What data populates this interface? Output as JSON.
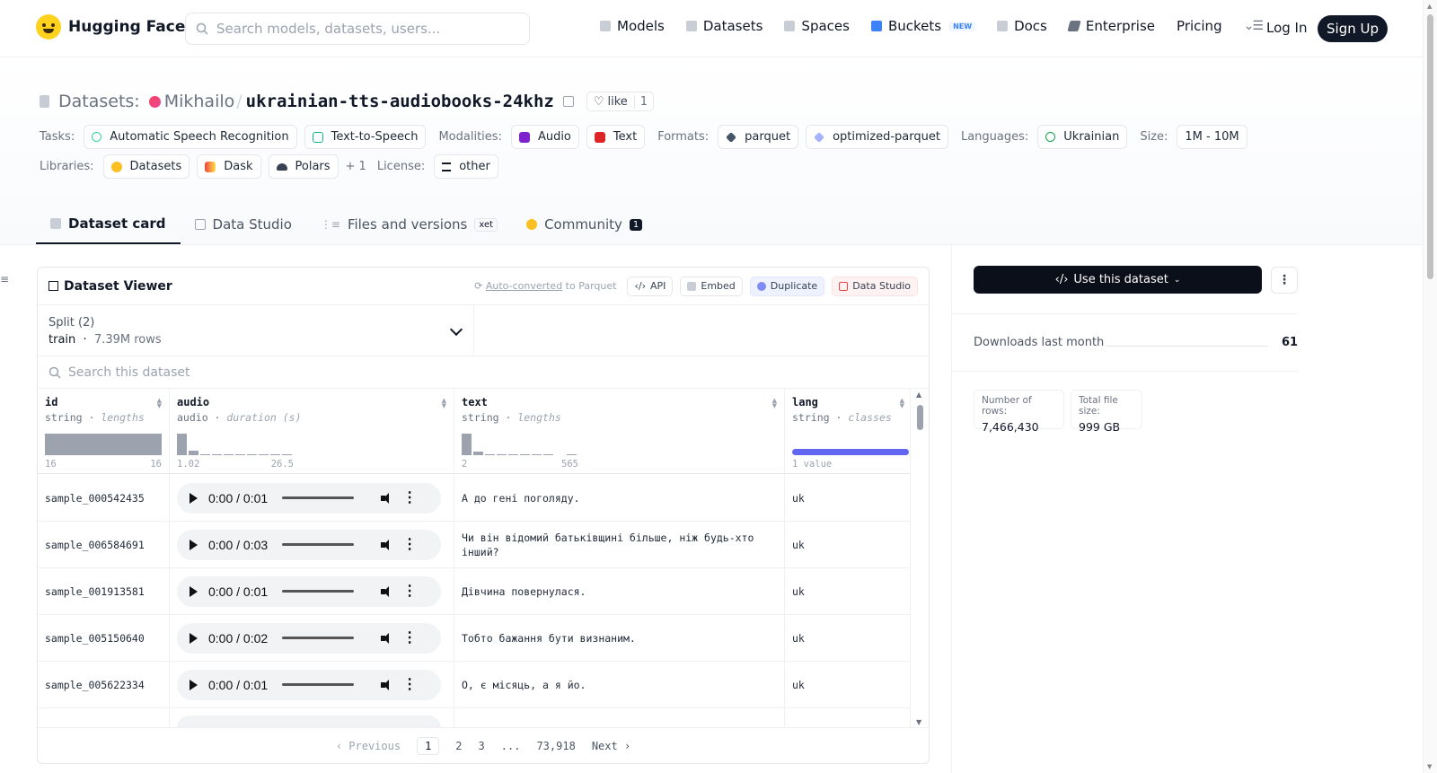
{
  "header": {
    "brand": "Hugging Face",
    "search_placeholder": "Search models, datasets, users...",
    "nav": [
      {
        "label": "Models"
      },
      {
        "label": "Datasets"
      },
      {
        "label": "Spaces"
      },
      {
        "label": "Buckets",
        "badge": "NEW"
      },
      {
        "label": "Docs"
      },
      {
        "label": "Enterprise"
      },
      {
        "label": "Pricing"
      }
    ],
    "login": "Log In",
    "signup": "Sign Up"
  },
  "dataset": {
    "prefix": "Datasets:",
    "owner": "Mikhailo",
    "separator": "/",
    "name": "ukrainian-tts-audiobooks-24khz",
    "like_label": "like",
    "like_count": "1"
  },
  "tags": {
    "tasks_label": "Tasks:",
    "tasks": [
      "Automatic Speech Recognition",
      "Text-to-Speech"
    ],
    "modalities_label": "Modalities:",
    "modalities": [
      "Audio",
      "Text"
    ],
    "formats_label": "Formats:",
    "formats": [
      "parquet",
      "optimized-parquet"
    ],
    "languages_label": "Languages:",
    "languages": [
      "Ukrainian"
    ],
    "size_label": "Size:",
    "size": "1M - 10M",
    "libraries_label": "Libraries:",
    "libraries": [
      "Datasets",
      "Dask",
      "Polars"
    ],
    "libraries_more": "+ 1",
    "license_label": "License:",
    "license": "other"
  },
  "tabs": [
    {
      "label": "Dataset card"
    },
    {
      "label": "Data Studio"
    },
    {
      "label": "Files and versions",
      "badge": "xet"
    },
    {
      "label": "Community",
      "count": "1"
    }
  ],
  "viewer": {
    "title": "Dataset Viewer",
    "auto_converted": "Auto-converted",
    "auto_suffix": " to Parquet",
    "actions": [
      "API",
      "Embed",
      "Duplicate",
      "Data Studio"
    ],
    "split_label": "Split (2)",
    "split_name": "train",
    "split_rows": "7.39M rows",
    "search_placeholder": "Search this dataset",
    "columns": [
      {
        "name": "id",
        "type": "string",
        "stat": "lengths",
        "min": "16",
        "max": "16"
      },
      {
        "name": "audio",
        "type": "audio",
        "stat": "duration (s)",
        "min": "1.02",
        "max": "26.5"
      },
      {
        "name": "text",
        "type": "string",
        "stat": "lengths",
        "min": "2",
        "max": "565"
      },
      {
        "name": "lang",
        "type": "string",
        "stat": "classes",
        "min": "1 value",
        "max": ""
      }
    ],
    "rows": [
      {
        "id": "sample_000542435",
        "time": "0:00 / 0:01",
        "text": "А до гені поголяду.",
        "lang": "uk"
      },
      {
        "id": "sample_006584691",
        "time": "0:00 / 0:03",
        "text": "Чи він відомий батьківщині більше, ніж будь-хто інший?",
        "lang": "uk"
      },
      {
        "id": "sample_001913581",
        "time": "0:00 / 0:01",
        "text": "Дівчина повернулася.",
        "lang": "uk"
      },
      {
        "id": "sample_005150640",
        "time": "0:00 / 0:02",
        "text": "Тобто бажання бути визнаним.",
        "lang": "uk"
      },
      {
        "id": "sample_005622334",
        "time": "0:00 / 0:01",
        "text": "О, є місяць, а я йо.",
        "lang": "uk"
      }
    ],
    "pager": {
      "prev": "Previous",
      "pages": [
        "1",
        "2",
        "3",
        "...",
        "73,918"
      ],
      "next": "Next"
    }
  },
  "sidebar": {
    "use_button": "Use this dataset",
    "downloads_label": "Downloads last month",
    "downloads_value": "61",
    "rows_label": "Number of rows:",
    "rows_value": "7,466,430",
    "size_label": "Total file size:",
    "size_value": "999 GB"
  }
}
